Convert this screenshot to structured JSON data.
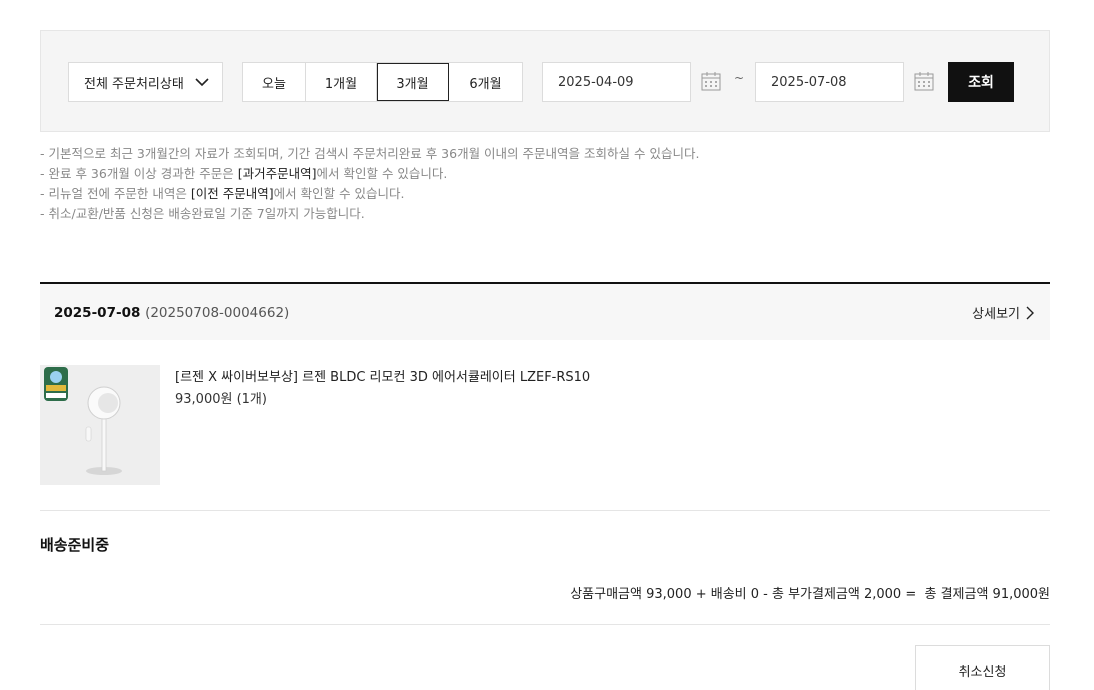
{
  "filter": {
    "status_select": "전체 주문처리상태",
    "periods": [
      "오늘",
      "1개월",
      "3개월",
      "6개월"
    ],
    "active_period": "3개월",
    "start_date": "2025-04-09",
    "end_date": "2025-07-08",
    "tilde": "~",
    "search_label": "조회"
  },
  "notes": {
    "line1": "- 기본적으로 최근 3개월간의 자료가 조회되며, 기간 검색시 주문처리완료 후 36개월 이내의 주문내역을 조회하실 수 있습니다.",
    "line2_pre": "- 완료 후 36개월 이상 경과한 주문은 ",
    "line2_bold": "[과거주문내역]",
    "line2_post": "에서 확인할 수 있습니다.",
    "line3_pre": "- 리뉴얼 전에 주문한 내역은 ",
    "line3_bold": "[이전 주문내역]",
    "line3_post": "에서 확인할 수 있습니다.",
    "line4": "- 취소/교환/반품 신청은 배송완료일 기준 7일까지 가능합니다."
  },
  "order": {
    "date": "2025-07-08",
    "number": "(20250708-0004662)",
    "detail_label": "상세보기",
    "product_name": "[르젠 X 싸이버보부상] 르젠 BLDC 리모컨 3D 에어서큘레이터 LZEF-RS10",
    "product_price": "93,000원 (1개)",
    "ship_status": "배송준비중",
    "summary": "상품구매금액 93,000 + 배송비 0 - 총 부가결제금액 2,000 =  총 결제금액 91,000원",
    "cancel_label": "취소신청"
  }
}
